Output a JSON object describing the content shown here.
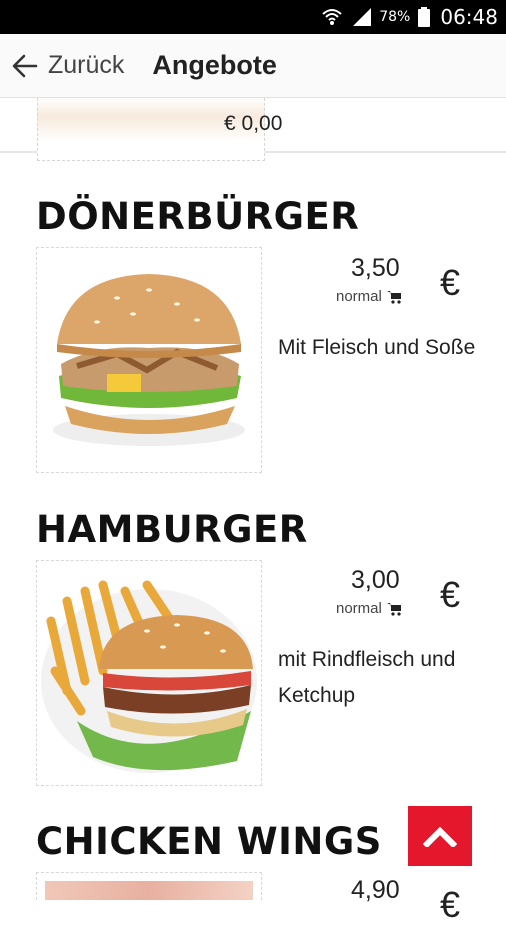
{
  "statusbar": {
    "battery": "78%",
    "time": "06:48"
  },
  "appbar": {
    "back_label": "Zurück",
    "title": "Angebote"
  },
  "prev_item": {
    "price": "€ 0,00"
  },
  "items": [
    {
      "title": "DÖNERBÜRGER",
      "price": "3,50",
      "size": "normal",
      "currency": "€",
      "description": "Mit Fleisch und Soße"
    },
    {
      "title": "HAMBURGER",
      "price": "3,00",
      "size": "normal",
      "currency": "€",
      "description": "mit Rindfleisch und Ketchup"
    },
    {
      "title": "CHICKEN WINGS",
      "price": "4,90",
      "currency": "€"
    }
  ],
  "colors": {
    "accent": "#e5172c",
    "statusbar": "#000000",
    "appbar": "#fafafa"
  }
}
